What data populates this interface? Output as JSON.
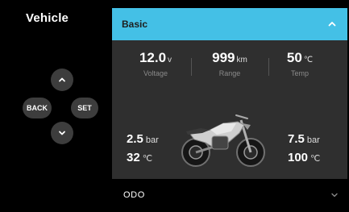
{
  "sidebar": {
    "title": "Vehicle",
    "dpad": {
      "back_label": "BACK",
      "set_label": "SET"
    }
  },
  "card": {
    "title": "Basic",
    "stats": {
      "voltage": {
        "value": "12.0",
        "unit": "v",
        "label": "Voltage"
      },
      "range": {
        "value": "999",
        "unit": "km",
        "label": "Range"
      },
      "temp": {
        "value": "50",
        "unit": "℃",
        "label": "Temp"
      }
    },
    "tires": {
      "front": {
        "pressure": "2.5",
        "pressure_unit": "bar",
        "temp": "32",
        "temp_unit": "℃"
      },
      "rear": {
        "pressure": "7.5",
        "pressure_unit": "bar",
        "temp": "100",
        "temp_unit": "℃"
      }
    }
  },
  "odo": {
    "label": "ODO"
  },
  "icons": {
    "up": "chevron-up-icon",
    "down": "chevron-down-icon",
    "collapse": "chevron-up-icon",
    "expand": "chevron-down-icon",
    "vehicle": "motorcycle-icon"
  },
  "colors": {
    "accent": "#44c0e6",
    "card_bg": "#2f2f2f",
    "button_bg": "#3d3d3d"
  }
}
